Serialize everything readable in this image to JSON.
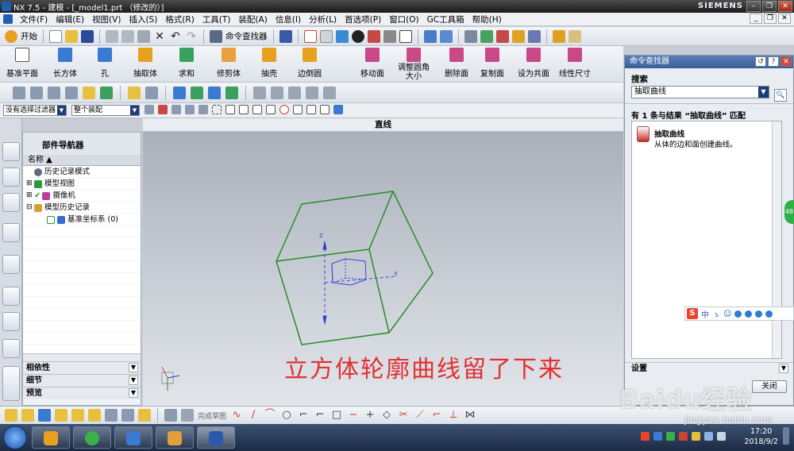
{
  "window": {
    "title": "NX 7.5 - 建模 - [_model1.prt （修改的）]",
    "brand": "SIEMENS"
  },
  "menu": {
    "items": [
      "文件(F)",
      "编辑(E)",
      "视图(V)",
      "插入(S)",
      "格式(R)",
      "工具(T)",
      "装配(A)",
      "信息(I)",
      "分析(L)",
      "首选项(P)",
      "窗口(O)",
      "GC工具箱",
      "帮助(H)"
    ]
  },
  "toolbar1": {
    "start_label": "开始",
    "command_finder_label": "命令查找器"
  },
  "toolbar2": {
    "buttons": [
      "基准平面",
      "长方体",
      "孔",
      "抽取体",
      "求和",
      "修剪体",
      "抽壳",
      "边倒圆",
      "移动面",
      "调整圆角大小",
      "删除面",
      "复制面",
      "设为共面",
      "线性尺寸"
    ]
  },
  "filters": {
    "selection_filter": "没有选择过滤器",
    "scope": "整个装配"
  },
  "status": {
    "prompt": "直线"
  },
  "navigator": {
    "title": "部件导航器",
    "column": "名称",
    "tree": [
      {
        "label": "历史记录模式",
        "indent": 1,
        "color": "#5a6a80"
      },
      {
        "label": "模型视图",
        "indent": 0,
        "color": "#2a9a3a"
      },
      {
        "label": "摄像机",
        "indent": 0,
        "color": "#c03aa0"
      },
      {
        "label": "模型历史记录",
        "indent": 0,
        "color": "#d8a030"
      },
      {
        "label": "基准坐标系 (0)",
        "indent": 2,
        "color": "#3a6ad0"
      }
    ],
    "sections": [
      "相依性",
      "细节",
      "预览"
    ]
  },
  "graphics": {
    "annotation": "立方体轮廓曲线留了下来"
  },
  "finder": {
    "title": "命令查找器",
    "search_section": "搜索",
    "search_value": "抽取曲线",
    "result_summary": "有 1 条与结果 “抽取曲线” 匹配",
    "result_name": "抽取曲线",
    "result_desc": "从体的边和面创建曲线。",
    "settings_section": "设置",
    "close_label": "关闭"
  },
  "bottom_toolbar": {
    "label": "完成草图"
  },
  "ime": {
    "chars": [
      "中",
      "ゝ",
      "☺"
    ]
  },
  "side_badge": "48",
  "taskbar": {
    "time": "17:20",
    "date": "2018/9/2"
  },
  "watermark": {
    "text": "Baidu经验",
    "url": "jingyan.baidu.com"
  }
}
